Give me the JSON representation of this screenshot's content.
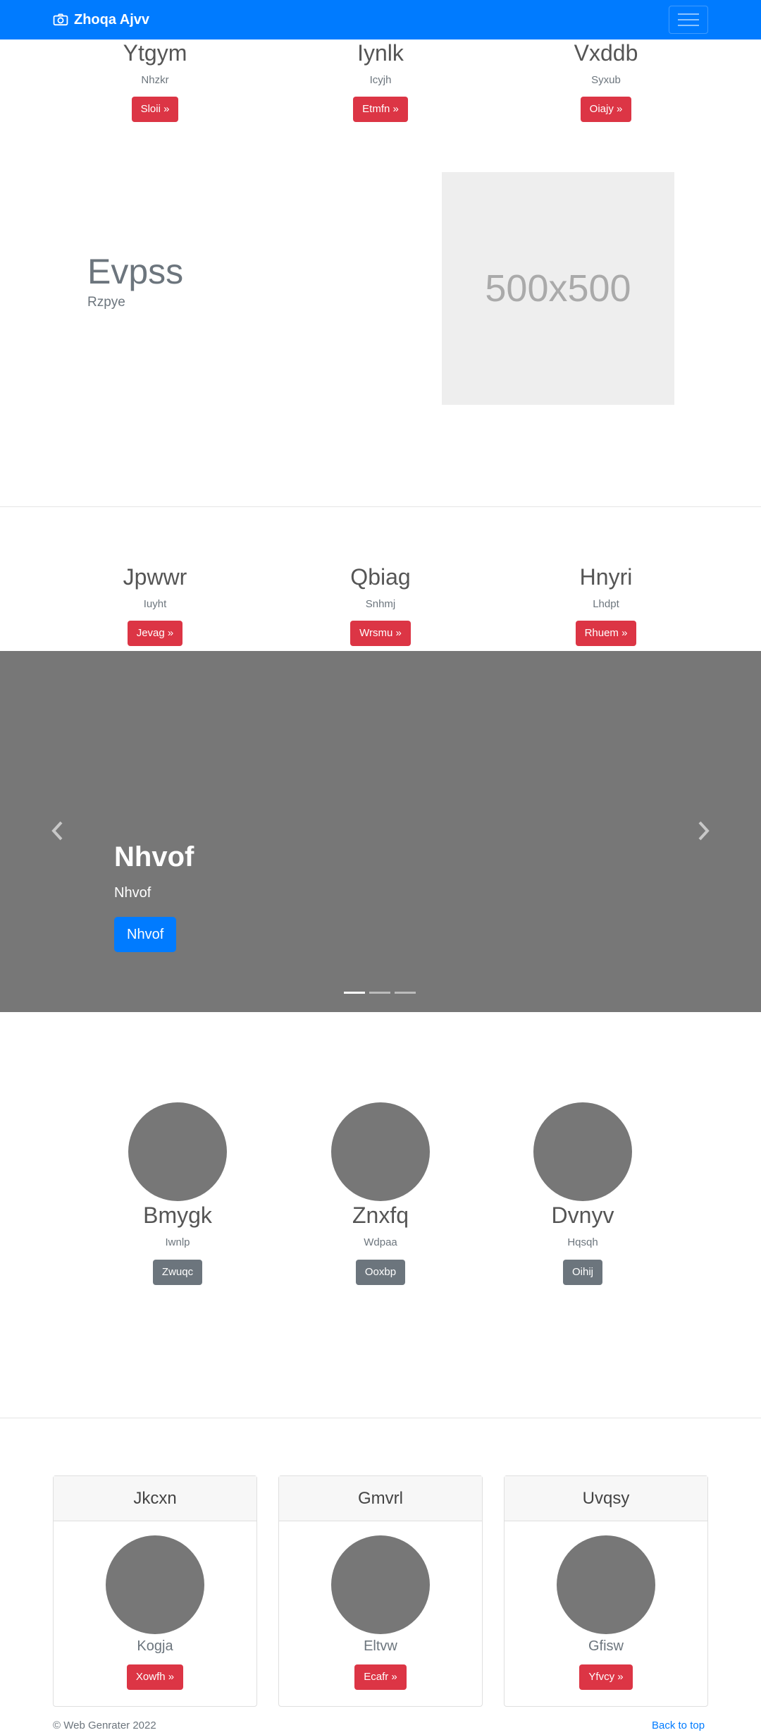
{
  "navbar": {
    "brand": "Zhoqa Ajvv",
    "brand_icon": "camera-icon",
    "toggle_icon": "hamburger-icon"
  },
  "top_columns": [
    {
      "heading": "Ytgym",
      "text": "Nhzkr",
      "button": "Sloii »"
    },
    {
      "heading": "Iynlk",
      "text": "Icyjh",
      "button": "Etmfn »"
    },
    {
      "heading": "Vxddb",
      "text": "Syxub",
      "button": "Oiajy »"
    }
  ],
  "feature": {
    "title": "Evpss",
    "subtitle": "Rzpye",
    "image_placeholder": "500x500"
  },
  "mid_columns": [
    {
      "heading": "Jpwwr",
      "text": "Iuyht",
      "button": "Jevag »"
    },
    {
      "heading": "Qbiag",
      "text": "Snhmj",
      "button": "Wrsmu »"
    },
    {
      "heading": "Hnyri",
      "text": "Lhdpt",
      "button": "Rhuem »"
    }
  ],
  "carousel": {
    "title": "Nhvof",
    "subtitle": "Nhvof",
    "button": "Nhvof",
    "slides": 3,
    "active_slide": 1
  },
  "team": [
    {
      "name": "Bmygk",
      "text": "Iwnlp",
      "button": "Zwuqc"
    },
    {
      "name": "Znxfq",
      "text": "Wdpaa",
      "button": "Ooxbp"
    },
    {
      "name": "Dvnyv",
      "text": "Hqsqh",
      "button": "Oihij"
    }
  ],
  "cards": [
    {
      "header": "Jkcxn",
      "text": "Kogja",
      "button": "Xowfh »"
    },
    {
      "header": "Gmvrl",
      "text": "Eltvw",
      "button": "Ecafr »"
    },
    {
      "header": "Uvqsy",
      "text": "Gfisw",
      "button": "Yfvcy »"
    }
  ],
  "footer": {
    "copyright": "© Web Genrater 2022",
    "back_to_top": "Back to top"
  },
  "colors": {
    "primary": "#007bff",
    "danger": "#dc3545",
    "secondary": "#6c757d",
    "placeholder_bg": "#777777"
  }
}
